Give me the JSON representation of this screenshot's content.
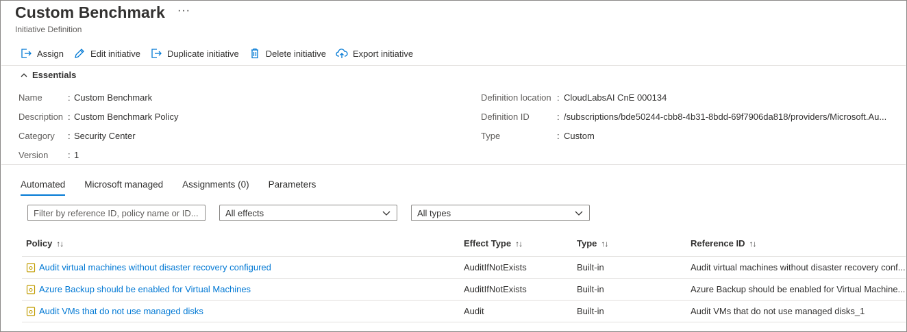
{
  "header": {
    "title": "Custom Benchmark",
    "more": "···",
    "subtitle": "Initiative Definition"
  },
  "toolbar": {
    "assign": "Assign",
    "edit": "Edit initiative",
    "duplicate": "Duplicate initiative",
    "delete": "Delete initiative",
    "export": "Export initiative"
  },
  "essentials": {
    "label": "Essentials",
    "left": [
      {
        "label": "Name",
        "value": "Custom Benchmark"
      },
      {
        "label": "Description",
        "value": "Custom Benchmark Policy"
      },
      {
        "label": "Category",
        "value": "Security Center"
      },
      {
        "label": "Version",
        "value": "1"
      }
    ],
    "right": [
      {
        "label": "Definition location",
        "value": "CloudLabsAI CnE 000134"
      },
      {
        "label": "Definition ID",
        "value": "/subscriptions/bde50244-cbb8-4b31-8bdd-69f7906da818/providers/Microsoft.Au..."
      },
      {
        "label": "Type",
        "value": "Custom"
      }
    ],
    "separator": ":"
  },
  "tabs": [
    "Automated",
    "Microsoft managed",
    "Assignments (0)",
    "Parameters"
  ],
  "filters": {
    "search_placeholder": "Filter by reference ID, policy name or ID...",
    "effects": "All effects",
    "types": "All types"
  },
  "table": {
    "columns": [
      "Policy",
      "Effect Type",
      "Type",
      "Reference ID"
    ],
    "sort_glyph": "↑↓",
    "rows": [
      {
        "policy": "Audit virtual machines without disaster recovery configured",
        "effect": "AuditIfNotExists",
        "type": "Built-in",
        "ref": "Audit virtual machines without disaster recovery conf..."
      },
      {
        "policy": "Azure Backup should be enabled for Virtual Machines",
        "effect": "AuditIfNotExists",
        "type": "Built-in",
        "ref": "Azure Backup should be enabled for Virtual Machine..."
      },
      {
        "policy": "Audit VMs that do not use managed disks",
        "effect": "Audit",
        "type": "Built-in",
        "ref": "Audit VMs that do not use managed disks_1"
      }
    ]
  },
  "colors": {
    "accent": "#0078d4",
    "policy_icon": "#c19c00"
  },
  "icons": {
    "assign": "assign-icon",
    "edit": "pencil-icon",
    "duplicate": "duplicate-icon",
    "delete": "trash-icon",
    "export": "cloud-upload-icon",
    "policy": "policy-icon"
  }
}
